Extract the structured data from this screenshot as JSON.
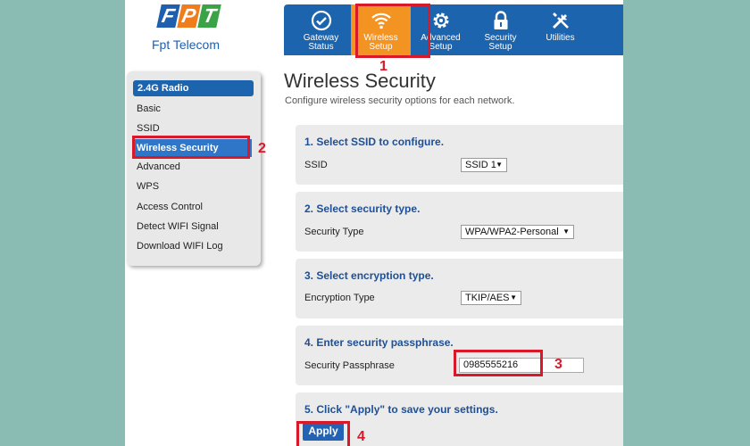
{
  "brand": {
    "logo_letters": [
      "F",
      "P",
      "T"
    ],
    "name": "Fpt Telecom",
    "colors": {
      "blue": "#1f5fae",
      "orange": "#f07c1c",
      "green": "#3aa346"
    }
  },
  "nav": {
    "items": [
      {
        "label": "Gateway\nStatus",
        "icon": "gauge-check-icon"
      },
      {
        "label": "Wireless\nSetup",
        "icon": "wifi-icon",
        "active": true
      },
      {
        "label": "Advanced\nSetup",
        "icon": "gear-icon"
      },
      {
        "label": "Security\nSetup",
        "icon": "lock-icon"
      },
      {
        "label": "Utilities",
        "icon": "tools-icon"
      }
    ],
    "colors": {
      "bar": "#1d64ae",
      "active": "#f39322"
    }
  },
  "sidebar": {
    "header": "2.4G Radio",
    "items": [
      "Basic",
      "SSID",
      "Wireless Security",
      "Advanced",
      "WPS",
      "Access Control",
      "Detect WIFI Signal",
      "Download WIFI Log"
    ],
    "active_index": 2
  },
  "page": {
    "title": "Wireless Security",
    "subtitle": "Configure wireless security options for each network."
  },
  "sections": {
    "ssid": {
      "title": "1. Select SSID to configure.",
      "label": "SSID",
      "value": "SSID 1"
    },
    "security_type": {
      "title": "2. Select security type.",
      "label": "Security Type",
      "value": "WPA/WPA2-Personal"
    },
    "encryption": {
      "title": "3. Select encryption type.",
      "label": "Encryption Type",
      "value": "TKIP/AES"
    },
    "passphrase": {
      "title": "4. Enter security passphrase.",
      "label": "Security Passphrase",
      "value": "0985555216"
    },
    "apply": {
      "title": "5. Click \"Apply\" to save your settings.",
      "button": "Apply"
    }
  },
  "callouts": [
    "1",
    "2",
    "3",
    "4"
  ],
  "callout_color": "#d7192a"
}
